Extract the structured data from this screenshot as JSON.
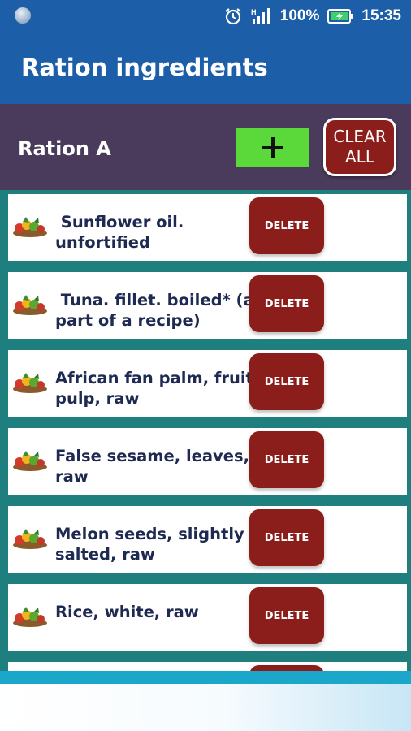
{
  "status_bar": {
    "battery_percent": "100%",
    "time": "15:35",
    "network": "H",
    "icons": [
      "status-dot-icon",
      "alarm-icon",
      "signal-icon",
      "battery-charging-icon"
    ]
  },
  "app_bar": {
    "title": "Ration ingredients"
  },
  "ration": {
    "name": "Ration A",
    "add_label": "+",
    "clear_all_label": "CLEAR\nALL"
  },
  "colors": {
    "primary": "#1c5ea8",
    "header": "#4a3a5c",
    "list_bg": "#1f7f7f",
    "add": "#5cd93a",
    "delete": "#8b1e1a",
    "item_text": "#1e2a52"
  },
  "ingredients": [
    {
      "name": " Sunflower oil.\nunfortified",
      "delete_label": "DELETE",
      "icon": "food-basket-icon"
    },
    {
      "name": " Tuna. fillet. boiled* (as\npart of a recipe)",
      "delete_label": "DELETE",
      "icon": "food-basket-icon"
    },
    {
      "name": "African fan palm, fruit,\npulp, raw",
      "delete_label": "DELETE",
      "icon": "food-basket-icon"
    },
    {
      "name": "False sesame, leaves,\nraw",
      "delete_label": "DELETE",
      "icon": "food-basket-icon"
    },
    {
      "name": "Melon seeds, slightly\nsalted, raw",
      "delete_label": "DELETE",
      "icon": "food-basket-icon"
    },
    {
      "name": "Rice, white, raw",
      "delete_label": "DELETE",
      "icon": "food-basket-icon"
    },
    {
      "name": "",
      "delete_label": "",
      "icon": "food-basket-icon"
    }
  ]
}
